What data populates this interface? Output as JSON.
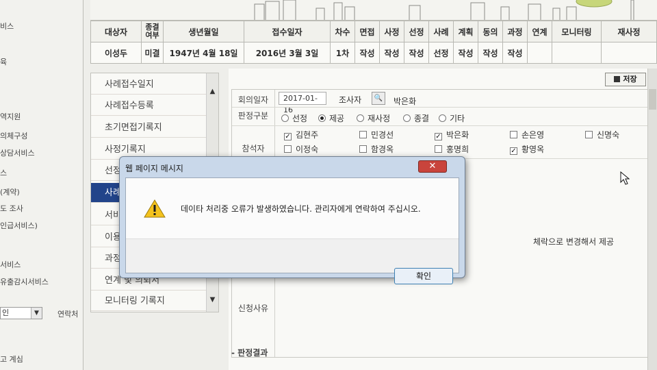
{
  "leftnav": {
    "items": [
      "비스",
      "육",
      "역지원",
      "의체구성",
      "상담서비스",
      "스",
      "(계약)",
      "도 조사",
      "인급서비스)",
      "서비스",
      "유출감시서비스"
    ],
    "select_value": "인",
    "link": "연락처",
    "login": "고 계심"
  },
  "status_table": {
    "headers": [
      "대상자",
      "종결 여부",
      "생년월일",
      "접수일자",
      "차수",
      "면접",
      "사정",
      "선정",
      "사례",
      "계획",
      "동의",
      "과정",
      "연계",
      "모니터링",
      "재사정"
    ],
    "row": [
      "이성두",
      "미결",
      "1947년 4월 18일",
      "2016년 3월 3일",
      "1차",
      "작성",
      "작성",
      "작성",
      "선정",
      "작성",
      "작성",
      "작성",
      "",
      "",
      ""
    ]
  },
  "sidemenu": {
    "items": [
      "사례접수일지",
      "사례접수등록",
      "초기면접기록지",
      "사정기록지",
      "선정",
      "사례",
      "서비",
      "이용",
      "과정",
      "연계 및 의뢰서",
      "모니터링 기록지"
    ],
    "active_index": 5
  },
  "form": {
    "save_label": "저장",
    "meeting_date_label": "회의일자",
    "meeting_date": "2017-01-16",
    "investigator_label": "조사자",
    "investigator": "박은화",
    "decision_label": "판정구분",
    "decision_options": [
      "선정",
      "제공",
      "재사정",
      "종결",
      "기타"
    ],
    "decision_selected": 1,
    "attendees_label": "참석자",
    "attendees": [
      {
        "name": "김현주",
        "checked": true
      },
      {
        "name": "민경선",
        "checked": false
      },
      {
        "name": "박은화",
        "checked": true
      },
      {
        "name": "손은영",
        "checked": false
      },
      {
        "name": "신명숙",
        "checked": false
      },
      {
        "name": "이정숙",
        "checked": false
      },
      {
        "name": "함경옥",
        "checked": false
      },
      {
        "name": "홍명희",
        "checked": false
      },
      {
        "name": "황영옥",
        "checked": true
      }
    ],
    "partial_text": "체락으로 변경해서 제공",
    "reason_label": "신청사유",
    "result_section": "- 판정결과"
  },
  "dialog": {
    "title": "웹 페이지 메시지",
    "message": "데이타 처리중 오류가 발생하였습니다. 관리자에게 연락하여 주십시오.",
    "ok_label": "확인",
    "close_label": "✕"
  }
}
